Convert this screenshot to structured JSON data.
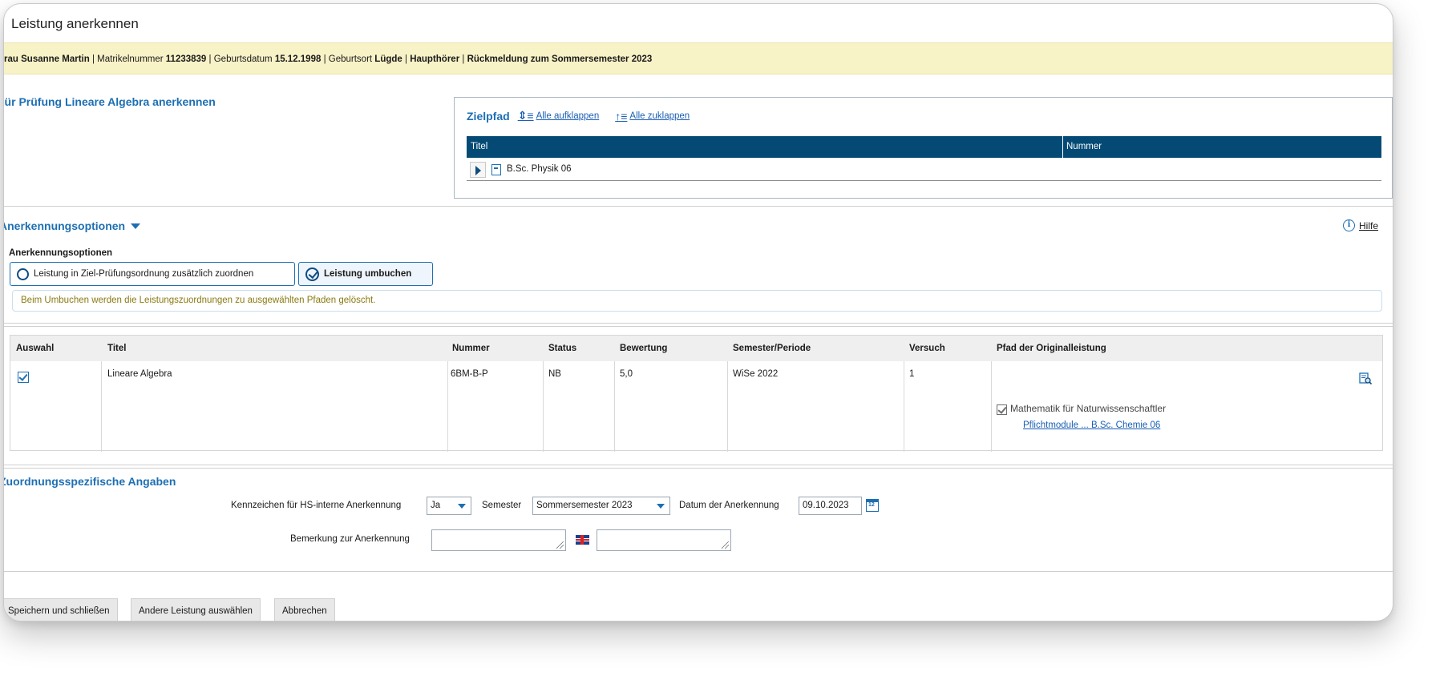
{
  "window": {
    "title": "Leistung anerkennen"
  },
  "student": {
    "salutation": "Frau",
    "name": "Susanne Martin",
    "matrikel_label": "Matrikelnummer",
    "matrikel": "11233839",
    "geburt_label": "Geburtsdatum",
    "geburtsdatum": "15.12.1998",
    "ort_label": "Geburtsort",
    "geburtsort": "Lügde",
    "hoerer": "Haupthörer",
    "rueckmeldung": "Rückmeldung zum Sommersemester 2023"
  },
  "pruefung": {
    "title": "Für Prüfung Lineare Algebra anerkennen"
  },
  "zielpfad": {
    "title": "Zielpfad",
    "expand_all": "Alle aufklappen",
    "collapse_all": "Alle zuklappen",
    "col_titel": "Titel",
    "col_nummer": "Nummer",
    "rows": [
      {
        "label": "B.Sc. Physik 06"
      }
    ]
  },
  "options": {
    "toggle": "Anerkennungsoptionen",
    "hilfe": "Hilfe",
    "group_label": "Anerkennungsoptionen",
    "opt1": "Leistung in Ziel-Prüfungsordnung zusätzlich zuordnen",
    "opt2": "Leistung umbuchen",
    "note": "Beim Umbuchen werden die Leistungszuordnungen zu ausgewählten Pfaden gelöscht."
  },
  "results": {
    "headers": [
      "Auswahl",
      "Titel",
      "Nummer",
      "Status",
      "Bewertung",
      "Semester/Periode",
      "Versuch",
      "Pfad der Originalleistung"
    ],
    "row": {
      "titel": "Lineare Algebra",
      "nummer": "6BM-B-P",
      "status": "NB",
      "bewertung": "5,0",
      "semester": "WiSe 2022",
      "versuch": "1",
      "pfad": "Mathematik für Naturwissenschaftler",
      "pfad_link": "Pflichtmodule ... B.Sc. Chemie 06"
    }
  },
  "zuordnung": {
    "title": "Zuordnungsspezifische Angaben",
    "kennzeichen_label": "Kennzeichen für HS-interne Anerkennung",
    "kennzeichen_value": "Ja",
    "semester_label": "Semester",
    "semester_value": "Sommersemester 2023",
    "datum_label": "Datum der Anerkennung",
    "datum_value": "09.10.2023",
    "bemerkung_label": "Bemerkung zur Anerkennung"
  },
  "buttons": {
    "save": "Speichern und schließen",
    "other": "Andere Leistung auswählen",
    "cancel": "Abbrechen"
  },
  "colors": {
    "accent": "#1d6fb3",
    "table_header": "#044a75",
    "infobar": "#f8f2c7",
    "note_text": "#8a7a12"
  }
}
